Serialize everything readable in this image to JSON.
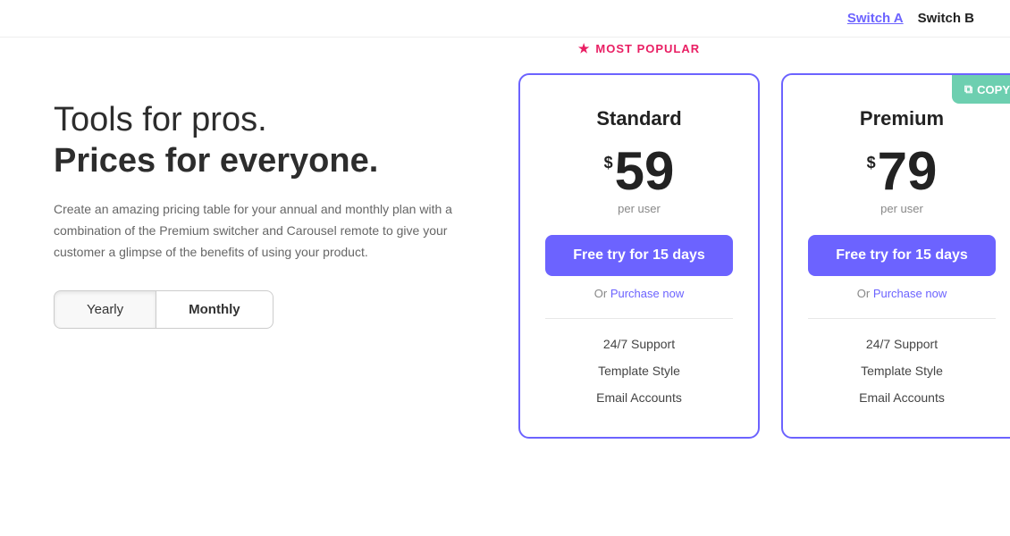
{
  "topbar": {
    "switch_a_label": "Switch A",
    "switch_b_label": "Switch B"
  },
  "left": {
    "headline_light": "Tools for pros.",
    "headline_bold": "Prices for everyone.",
    "description": "Create an amazing pricing table for your annual and monthly plan with a combination of the Premium switcher and Carousel remote to give your customer a glimpse of the benefits of using your product.",
    "toggle_yearly": "Yearly",
    "toggle_monthly": "Monthly"
  },
  "popular_badge": "MOST POPULAR",
  "cards": [
    {
      "id": "standard",
      "title": "Standard",
      "currency": "$",
      "price": "59",
      "per_user": "per user",
      "cta_label": "Free try for 15 days",
      "purchase_prefix": "Or ",
      "purchase_label": "Purchase now",
      "features": [
        "24/7 Support",
        "Template Style",
        "Email Accounts"
      ],
      "copy_btn": null
    },
    {
      "id": "premium",
      "title": "Premium",
      "currency": "$",
      "price": "79",
      "per_user": "per user",
      "cta_label": "Free try for 15 days",
      "purchase_prefix": "Or ",
      "purchase_label": "Purchase now",
      "features": [
        "24/7 Support",
        "Template Style",
        "Email Accounts"
      ],
      "copy_btn": "COPY"
    }
  ],
  "icons": {
    "star": "★",
    "copy": "⧉"
  }
}
